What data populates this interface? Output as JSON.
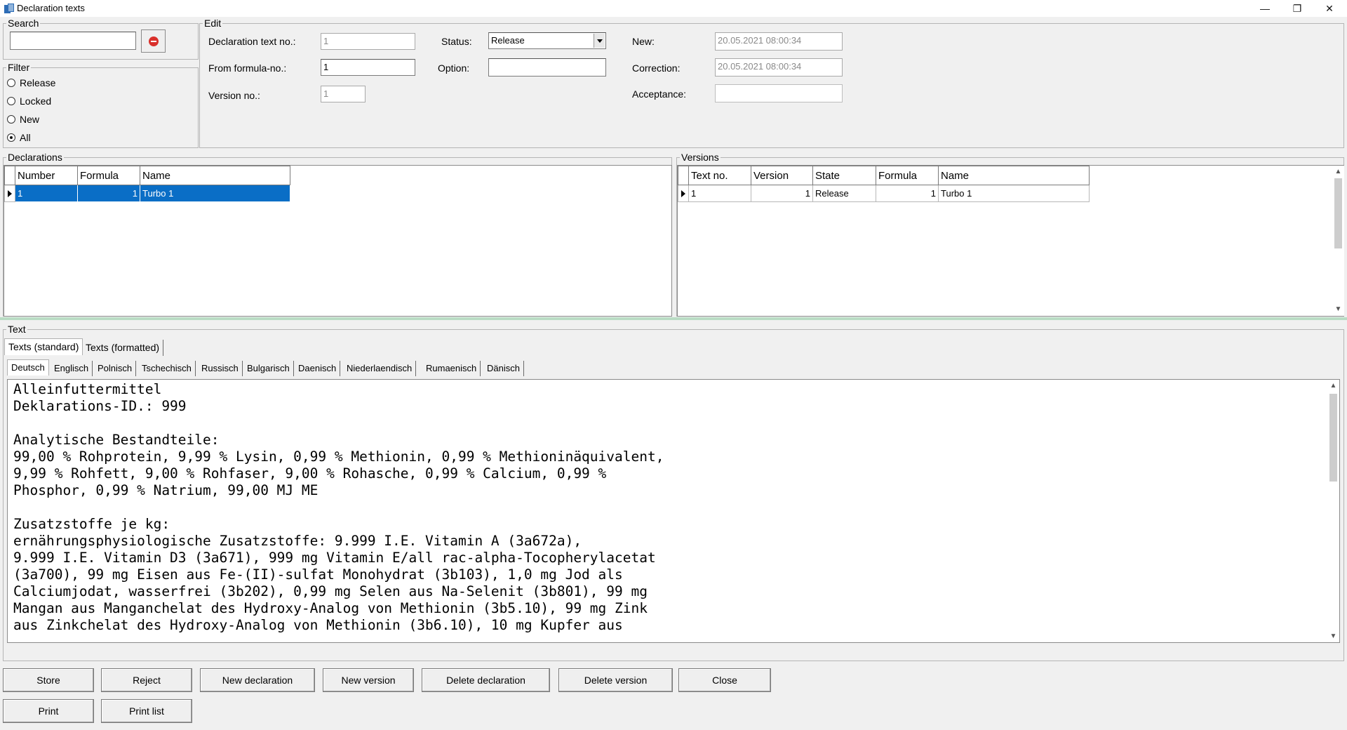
{
  "window": {
    "title": "Declaration texts",
    "minimize_icon": "minimize-icon",
    "restore_icon": "restore-icon",
    "close_icon": "close-icon"
  },
  "search": {
    "label": "Search",
    "value": "",
    "clear_icon": "clear-icon"
  },
  "filter": {
    "label": "Filter",
    "options": [
      {
        "label": "Release",
        "checked": false
      },
      {
        "label": "Locked",
        "checked": false
      },
      {
        "label": "New",
        "checked": false
      },
      {
        "label": "All",
        "checked": true
      }
    ]
  },
  "edit": {
    "label": "Edit",
    "declaration_text_no_label": "Declaration text no.:",
    "declaration_text_no": "1",
    "from_formula_no_label": "From formula-no.:",
    "from_formula_no": "1",
    "version_no_label": "Version no.:",
    "version_no": "1",
    "status_label": "Status:",
    "status": "Release",
    "option_label": "Option:",
    "option": "",
    "new_label": "New:",
    "new": "20.05.2021 08:00:34",
    "correction_label": "Correction:",
    "correction": "20.05.2021 08:00:34",
    "acceptance_label": "Acceptance:",
    "acceptance": ""
  },
  "declarations": {
    "label": "Declarations",
    "columns": [
      "Number",
      "Formula",
      "Name"
    ],
    "rows": [
      {
        "number": "1",
        "formula": "1",
        "name": "Turbo 1"
      }
    ]
  },
  "versions": {
    "label": "Versions",
    "columns": [
      "Text no.",
      "Version",
      "State",
      "Formula",
      "Name"
    ],
    "rows": [
      {
        "text_no": "1",
        "version": "1",
        "state": "Release",
        "formula": "1",
        "name": "Turbo 1"
      }
    ]
  },
  "text": {
    "label": "Text",
    "tabs": [
      "Texts (standard)",
      "Texts (formatted)"
    ],
    "language_tabs": [
      "Deutsch",
      "Englisch",
      "Polnisch",
      "Tschechisch",
      "Russisch",
      "Bulgarisch",
      "Daenisch",
      "Niederlaendisch",
      "Rumaenisch",
      "Dänisch"
    ],
    "content": "Alleinfuttermittel\nDeklarations-ID.: 999\n\nAnalytische Bestandteile:\n99,00 % Rohprotein, 9,99 % Lysin, 0,99 % Methionin, 0,99 % Methioninäquivalent,\n9,99 % Rohfett, 9,00 % Rohfaser, 9,00 % Rohasche, 0,99 % Calcium, 0,99 %\nPhosphor, 0,99 % Natrium, 99,00 MJ ME\n\nZusatzstoffe je kg:\nernährungsphysiologische Zusatzstoffe: 9.999 I.E. Vitamin A (3a672a),\n9.999 I.E. Vitamin D3 (3a671), 999 mg Vitamin E/all rac-alpha-Tocopherylacetat\n(3a700), 99 mg Eisen aus Fe-(II)-sulfat Monohydrat (3b103), 1,0 mg Jod als\nCalciumjodat, wasserfrei (3b202), 0,99 mg Selen aus Na-Selenit (3b801), 99 mg\nMangan aus Manganchelat des Hydroxy-Analog von Methionin (3b5.10), 99 mg Zink\naus Zinkchelat des Hydroxy-Analog von Methionin (3b6.10), 10 mg Kupfer aus"
  },
  "buttons": {
    "store": "Store",
    "reject": "Reject",
    "new_declaration": "New declaration",
    "new_version": "New version",
    "delete_declaration": "Delete declaration",
    "delete_version": "Delete version",
    "close": "Close",
    "print": "Print",
    "print_list": "Print list"
  },
  "colors": {
    "selection": "#0a6ec6",
    "splitter": "#b9dcc4",
    "clear_button": "#d9302b"
  }
}
